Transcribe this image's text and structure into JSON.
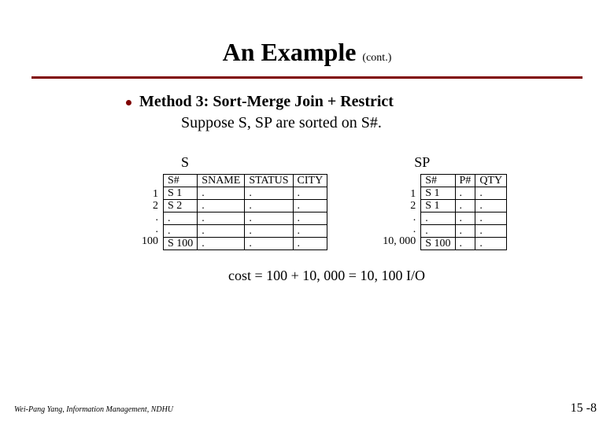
{
  "title": {
    "main": "An Example",
    "cont": "(cont.)"
  },
  "bullet": {
    "method_label": "Method 3:",
    "method_text": " Sort-Merge Join + Restrict",
    "suppose": "Suppose S, SP are sorted on S#."
  },
  "tableS": {
    "label": "S",
    "headers": [
      "S#",
      "SNAME",
      "STATUS",
      "CITY"
    ],
    "rownums": [
      "1",
      "2",
      ".",
      ".",
      "100"
    ],
    "rows": [
      [
        "S 1",
        ".",
        ".",
        "."
      ],
      [
        "S 2",
        ".",
        ".",
        "."
      ],
      [
        ".",
        ".",
        ".",
        "."
      ],
      [
        ".",
        ".",
        ".",
        "."
      ],
      [
        "S 100",
        ".",
        ".",
        "."
      ]
    ]
  },
  "tableSP": {
    "label": "SP",
    "headers": [
      "S#",
      "P#",
      "QTY"
    ],
    "rownums": [
      "1",
      "2",
      ".",
      ".",
      "10, 000"
    ],
    "rows": [
      [
        "S 1",
        ".",
        "."
      ],
      [
        "S 1",
        ".",
        "."
      ],
      [
        ".",
        ".",
        "."
      ],
      [
        ".",
        ".",
        "."
      ],
      [
        "S 100",
        ".",
        "."
      ]
    ]
  },
  "cost": "cost = 100 + 10, 000 = 10, 100 I/O",
  "footer": {
    "left": "Wei-Pang Yang, Information Management, NDHU",
    "right": "15 -8"
  }
}
